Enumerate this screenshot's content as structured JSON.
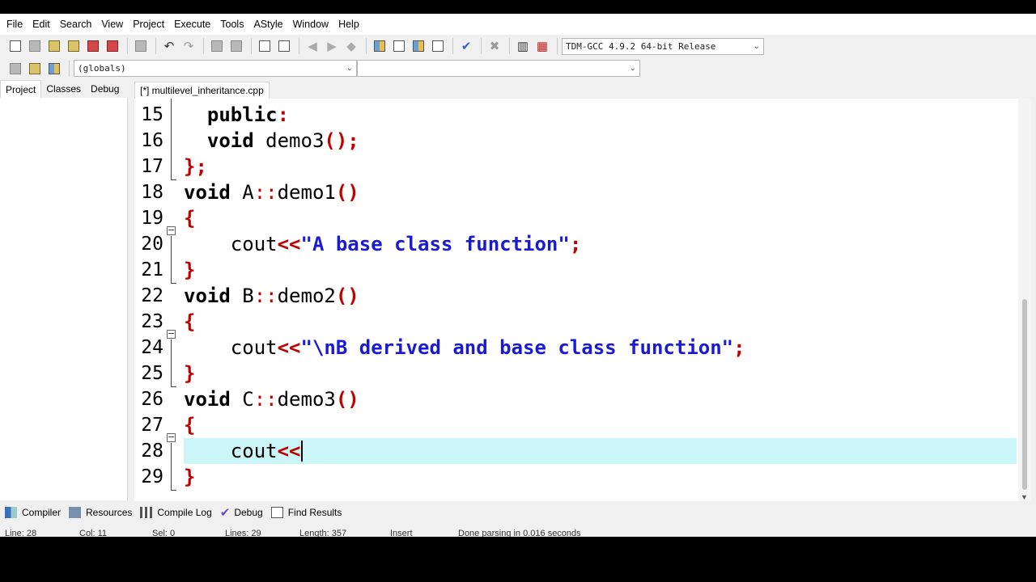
{
  "menu": [
    "File",
    "Edit",
    "Search",
    "View",
    "Project",
    "Execute",
    "Tools",
    "AStyle",
    "Window",
    "Help"
  ],
  "toolbar": {
    "compiler_select": "TDM-GCC 4.9.2 64-bit Release",
    "globals_select": "(globals)",
    "symbol_select": ""
  },
  "left_tabs": [
    "Project",
    "Classes",
    "Debug"
  ],
  "editor": {
    "tab_title": "[*] multilevel_inheritance.cpp",
    "line_numbers": [
      "15",
      "16",
      "17",
      "18",
      "19",
      "20",
      "21",
      "22",
      "23",
      "24",
      "25",
      "26",
      "27",
      "28",
      "29"
    ]
  },
  "code": {
    "l15": {
      "kw": "public",
      "sym": ":"
    },
    "l16": {
      "kw": "void",
      "id": " demo3",
      "sym": "();"
    },
    "l17": {
      "sym1": "}",
      "sym2": ";"
    },
    "l18": {
      "kw": "void",
      "id1": " A",
      "sym1": "::",
      "id2": "demo1",
      "sym2": "()"
    },
    "l19": {
      "sym": "{"
    },
    "l20": {
      "id": "cout",
      "sym1": "<<",
      "str": "\"A base class function\"",
      "sym2": ";"
    },
    "l21": {
      "sym": "}"
    },
    "l22": {
      "kw": "void",
      "id1": " B",
      "sym1": "::",
      "id2": "demo2",
      "sym2": "()"
    },
    "l23": {
      "sym": "{"
    },
    "l24": {
      "id": "cout",
      "sym1": "<<",
      "str": "\"\\nB derived and base class function\"",
      "sym2": ";"
    },
    "l25": {
      "sym": "}"
    },
    "l26": {
      "kw": "void",
      "id1": " C",
      "sym1": "::",
      "id2": "demo3",
      "sym2": "()"
    },
    "l27": {
      "sym": "{"
    },
    "l28": {
      "id": "cout",
      "sym1": "<<"
    },
    "l29": {
      "sym": "}"
    }
  },
  "bottom_tabs": [
    "Compiler",
    "Resources",
    "Compile Log",
    "Debug",
    "Find Results"
  ],
  "status": {
    "line": "Line:   28",
    "col": "Col:   11",
    "sel": "Sel:   0",
    "lines": "Lines:   29",
    "length": "Length:   357",
    "mode": "Insert",
    "message": "Done parsing in 0.016 seconds"
  },
  "colors": {
    "keyword": "#000000",
    "symbol": "#c00000",
    "string": "#1a1ad4",
    "current_line": "#ccf5f7"
  }
}
